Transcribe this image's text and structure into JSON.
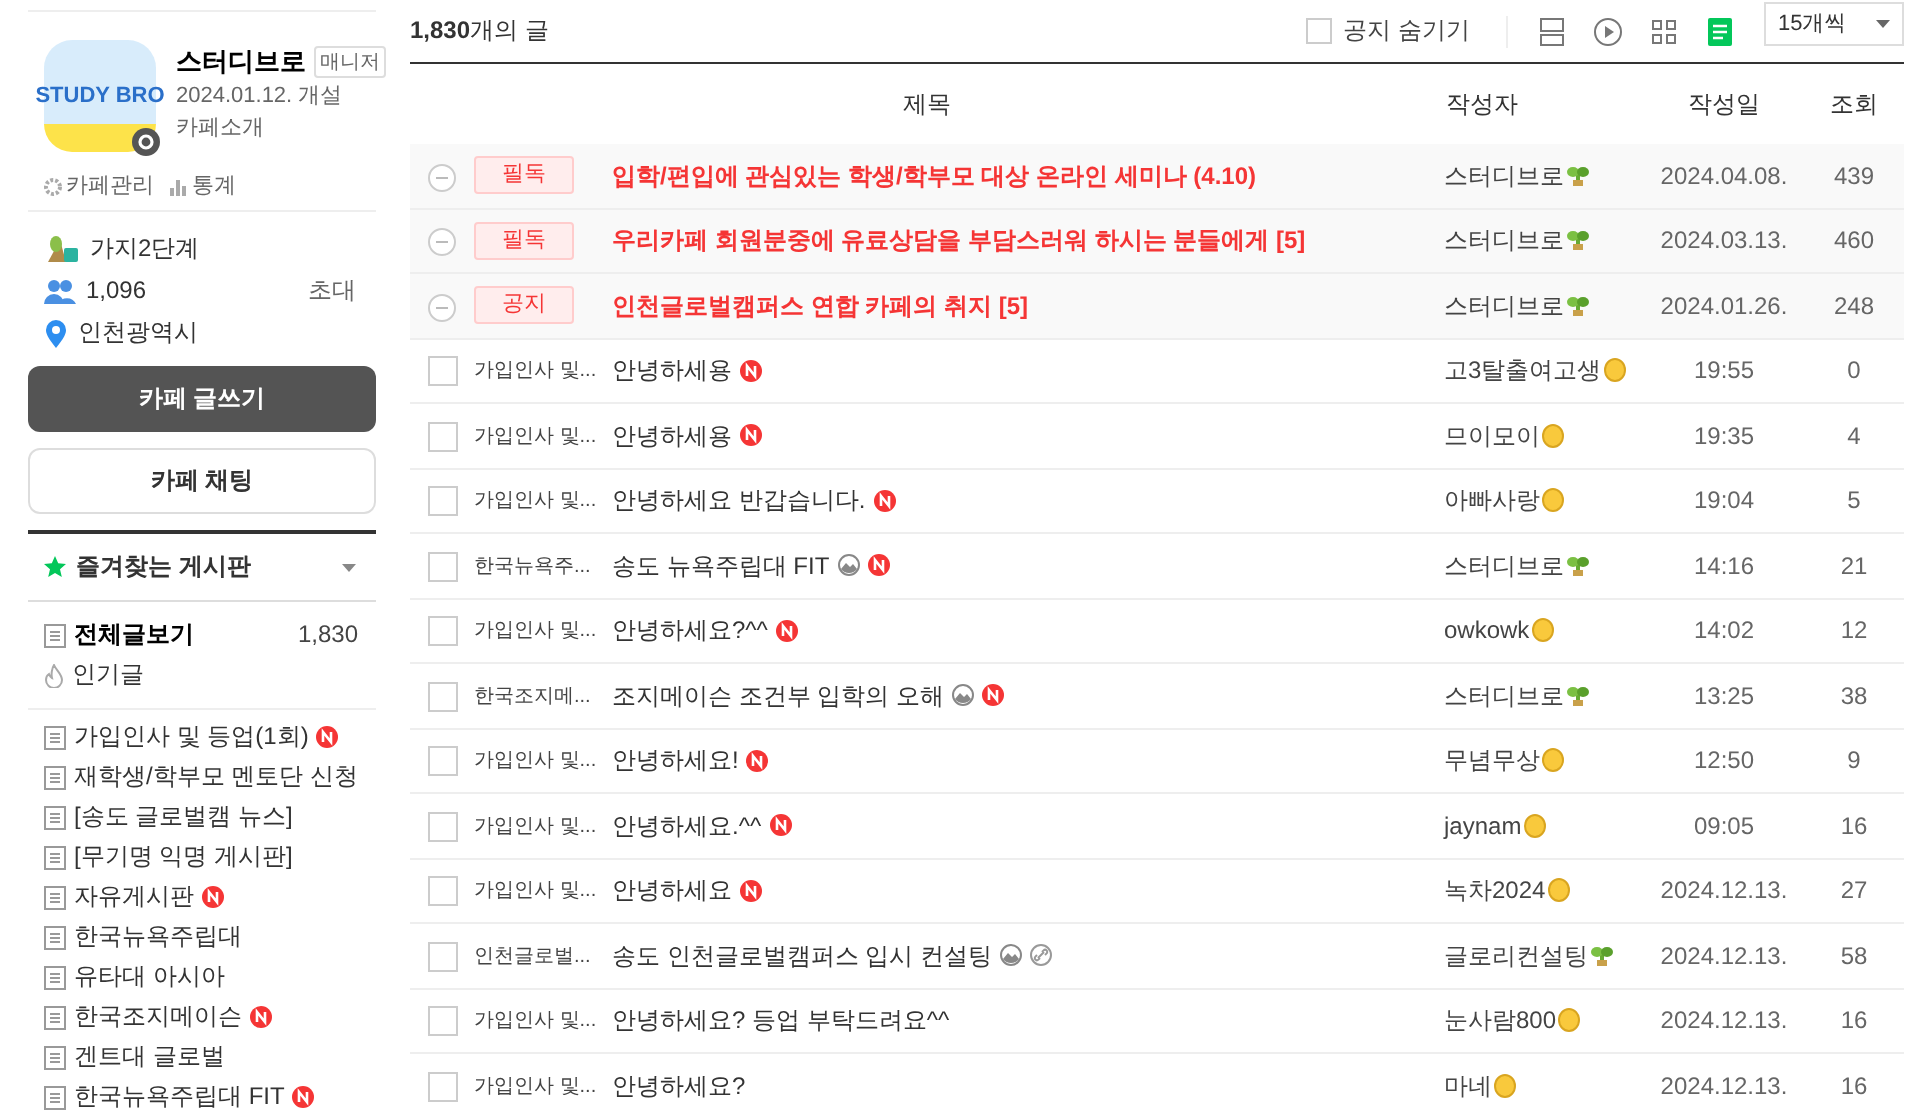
{
  "cafe": {
    "name": "스터디브로",
    "role": "매니저",
    "founded": "2024.01.12. 개설",
    "intro": "카페소개",
    "logo_text": "STUDY BRO",
    "manage": "카페관리",
    "stats": "통계"
  },
  "info": {
    "level": "가지2단계",
    "members": "1,096",
    "invite": "초대",
    "location": "인천광역시"
  },
  "write_button": "카페 글쓰기",
  "chat_button": "카페 채팅",
  "favorites": {
    "title": "즐겨찾는 게시판"
  },
  "all_posts": {
    "label": "전체글보기",
    "count": "1,830"
  },
  "popular": "인기글",
  "boards": [
    {
      "label": "가입인사 및 등업(1회)",
      "new": true
    },
    {
      "label": "재학생/학부모 멘토단 신청",
      "new": false
    },
    {
      "label": "[송도 글로벌캠 뉴스]",
      "new": false
    },
    {
      "label": "[무기명 익명 게시판]",
      "new": false
    },
    {
      "label": "자유게시판",
      "new": true
    },
    {
      "label": "한국뉴욕주립대",
      "new": false
    },
    {
      "label": "유타대 아시아",
      "new": false
    },
    {
      "label": "한국조지메이슨",
      "new": true
    },
    {
      "label": "겐트대 글로벌",
      "new": false
    },
    {
      "label": "한국뉴욕주립대 FIT",
      "new": true
    }
  ],
  "toolbar": {
    "count": "**1,830**개의 글",
    "hide_notice": {
      "label": "공지 숨기기",
      "checked": false
    },
    "views": [
      {
        "kind": "card",
        "selected": false
      },
      {
        "kind": "play",
        "selected": false
      },
      {
        "kind": "grid",
        "selected": false
      },
      {
        "kind": "list",
        "selected": true
      }
    ],
    "page_size": "15개씩"
  },
  "columns": [
    "제목",
    "작성자",
    "작성일",
    "조회"
  ],
  "notices": [
    {
      "tag": "필독",
      "title": "입학/편입에 관심있는 학생/학부모 대상 온라인 세미나 (4.10)",
      "author": "스터디브로",
      "badge": {
        "kind": "sprout"
      },
      "date": "2024.04.08.",
      "views": "439"
    },
    {
      "tag": "필독",
      "title": "우리카페 회원분중에 유료상담을 부담스러워 하시는 분들에게 [5]",
      "author": "스터디브로",
      "badge": {
        "kind": "sprout"
      },
      "date": "2024.03.13.",
      "views": "460"
    },
    {
      "tag": "공지",
      "title": "인천글로벌캠퍼스 연합 카페의 취지 [5]",
      "author": "스터디브로",
      "badge": {
        "kind": "sprout"
      },
      "date": "2024.01.26.",
      "views": "248"
    }
  ],
  "rows": [
    {
      "checked": false,
      "board": "가입인사 및...",
      "title": "안녕하세용",
      "icons": [
        {
          "kind": "new"
        }
      ],
      "author": "고3탈출여고생",
      "badge": {
        "kind": "egg"
      },
      "date": "19:55",
      "views": "0"
    },
    {
      "checked": false,
      "board": "가입인사 및...",
      "title": "안녕하세용",
      "icons": [
        {
          "kind": "new"
        }
      ],
      "author": "므이모이",
      "badge": {
        "kind": "egg"
      },
      "date": "19:35",
      "views": "4"
    },
    {
      "checked": false,
      "board": "가입인사 및...",
      "title": "안녕하세요 반갑습니다.",
      "icons": [
        {
          "kind": "new"
        }
      ],
      "author": "아빠사랑",
      "badge": {
        "kind": "egg"
      },
      "date": "19:04",
      "views": "5"
    },
    {
      "checked": false,
      "board": "한국뉴욕주...",
      "title": "송도 뉴욕주립대 FIT",
      "icons": [
        {
          "kind": "image"
        },
        {
          "kind": "new"
        }
      ],
      "author": "스터디브로",
      "badge": {
        "kind": "sprout"
      },
      "date": "14:16",
      "views": "21"
    },
    {
      "checked": false,
      "board": "가입인사 및...",
      "title": "안녕하세요?^^",
      "icons": [
        {
          "kind": "new"
        }
      ],
      "author": "owkowk",
      "badge": {
        "kind": "egg"
      },
      "date": "14:02",
      "views": "12"
    },
    {
      "checked": false,
      "board": "한국조지메...",
      "title": "조지메이슨 조건부 입학의 오해",
      "icons": [
        {
          "kind": "image"
        },
        {
          "kind": "new"
        }
      ],
      "author": "스터디브로",
      "badge": {
        "kind": "sprout"
      },
      "date": "13:25",
      "views": "38"
    },
    {
      "checked": false,
      "board": "가입인사 및...",
      "title": "안녕하세요!",
      "icons": [
        {
          "kind": "new"
        }
      ],
      "author": "무념무상",
      "badge": {
        "kind": "egg"
      },
      "date": "12:50",
      "views": "9"
    },
    {
      "checked": false,
      "board": "가입인사 및...",
      "title": "안녕하세요.^^",
      "icons": [
        {
          "kind": "new"
        }
      ],
      "author": "jaynam",
      "badge": {
        "kind": "egg"
      },
      "date": "09:05",
      "views": "16"
    },
    {
      "checked": false,
      "board": "가입인사 및...",
      "title": "안녕하세요",
      "icons": [
        {
          "kind": "new"
        }
      ],
      "author": "녹차2024",
      "badge": {
        "kind": "egg"
      },
      "date": "2024.12.13.",
      "views": "27"
    },
    {
      "checked": false,
      "board": "인천글로벌...",
      "title": "송도 인천글로벌캠퍼스 입시 컨설팅",
      "icons": [
        {
          "kind": "image"
        },
        {
          "kind": "link"
        }
      ],
      "author": "글로리컨설팅",
      "badge": {
        "kind": "sprout"
      },
      "date": "2024.12.13.",
      "views": "58"
    },
    {
      "checked": false,
      "board": "가입인사 및...",
      "title": "안녕하세요? 등업 부탁드려요^^",
      "icons": [],
      "author": "눈사람800",
      "badge": {
        "kind": "egg"
      },
      "date": "2024.12.13.",
      "views": "16"
    },
    {
      "checked": false,
      "board": "가입인사 및...",
      "title": "안녕하세요?",
      "icons": [],
      "author": "마네",
      "badge": {
        "kind": "egg"
      },
      "date": "2024.12.13.",
      "views": "16"
    }
  ]
}
